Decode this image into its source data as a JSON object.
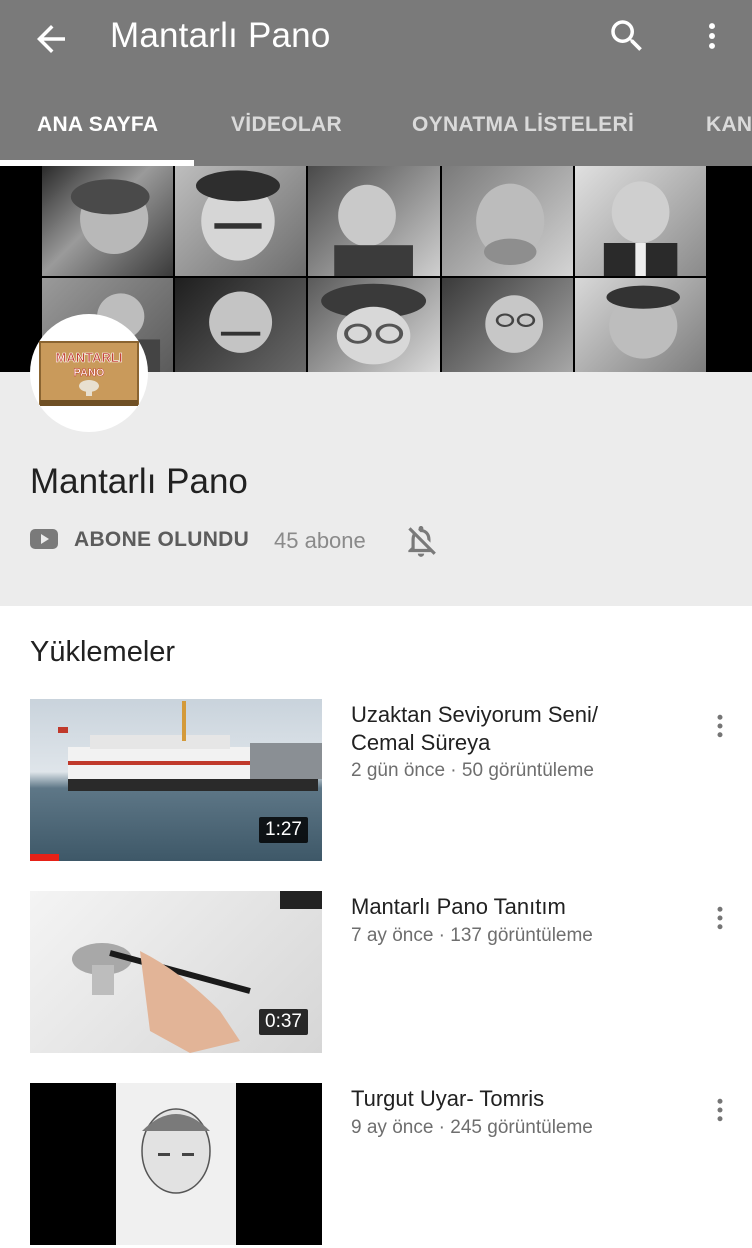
{
  "appbar": {
    "title": "Mantarlı Pano",
    "color": "#7a7a7a"
  },
  "tabs": [
    {
      "label": "ANA SAYFA",
      "active": true
    },
    {
      "label": "VİDEOLAR",
      "active": false
    },
    {
      "label": "OYNATMA LİSTELERİ",
      "active": false
    },
    {
      "label": "KAN",
      "active": false
    }
  ],
  "channel": {
    "name": "Mantarlı Pano",
    "logo_text": "MANTARLI PANO",
    "subscribe_label": "ABONE OLUNDU",
    "subscriber_count": "45 abone"
  },
  "uploads": {
    "title": "Yüklemeler",
    "videos": [
      {
        "title": "Uzaktan Seviyorum Seni/ Cemal Süreya",
        "meta": "2 gün önce · 50 görüntüleme",
        "duration": "1:27",
        "watched_fraction": 0.1
      },
      {
        "title": "Mantarlı Pano Tanıtım",
        "meta": "7 ay önce · 137 görüntüleme",
        "duration": "0:37"
      },
      {
        "title": "Turgut Uyar- Tomris",
        "meta": "9 ay önce · 245 görüntüleme"
      }
    ]
  },
  "icons": {
    "back": "arrow-left-icon",
    "search": "search-icon",
    "more": "more-vert-icon",
    "youtube": "youtube-icon",
    "bell": "bell-off-icon"
  },
  "colors": {
    "accent": "#e62117",
    "background": "#ececec"
  }
}
